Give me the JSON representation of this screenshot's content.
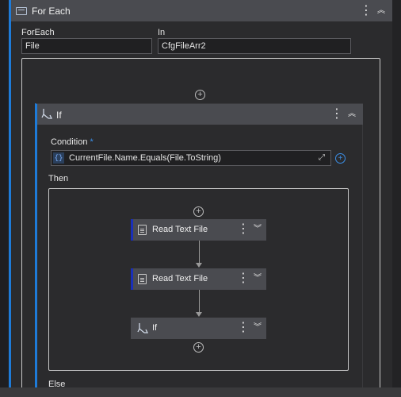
{
  "foreach": {
    "title": "For Each",
    "foreach_label": "ForEach",
    "foreach_value": "File",
    "in_label": "In",
    "in_value": "CfgFileArr2",
    "kebab": "⋮",
    "collapse": "︽"
  },
  "if": {
    "title": "If",
    "kebab": "⋮",
    "collapse": "︽",
    "condition_label": "Condition",
    "required_mark": "*",
    "condition_value": "CurrentFile.Name.Equals(File.ToString)",
    "expr_icon": "{}",
    "then_label": "Then",
    "else_label": "Else"
  },
  "then_activities": [
    {
      "label": "Read Text File",
      "icon": "document-icon"
    },
    {
      "label": "Read Text File",
      "icon": "document-icon"
    },
    {
      "label": "If",
      "icon": "if-branch-icon"
    }
  ],
  "card_controls": {
    "kebab": "⋮",
    "expand": "︾"
  },
  "plus_glyph": "+",
  "expand_glyph": "⤢",
  "colors": {
    "accent": "#1e7bd8",
    "header_bg": "#4a4b50",
    "canvas_bg": "#2b2b2d",
    "selected_bar": "#1a2fb8",
    "required": "#3b8fe8"
  }
}
